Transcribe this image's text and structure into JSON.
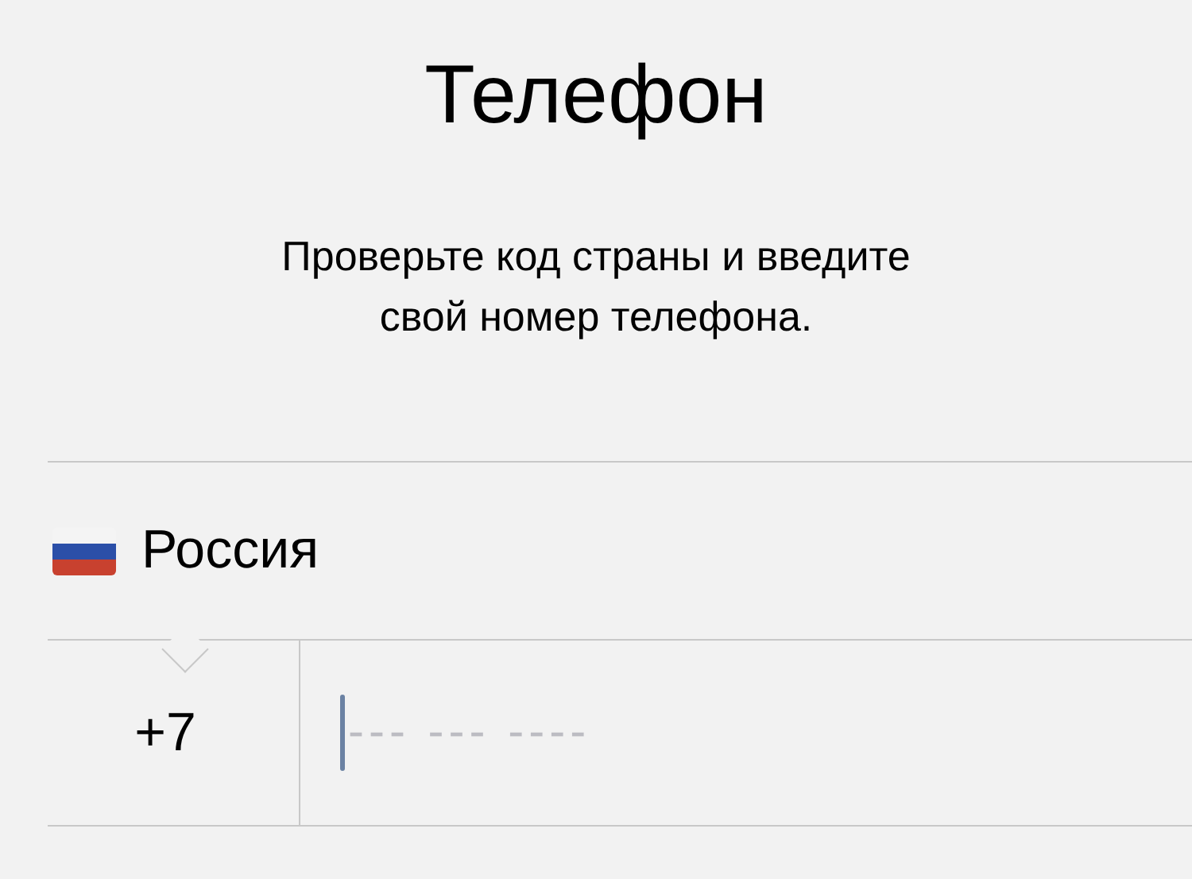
{
  "title": "Телефон",
  "subtitle": "Проверьте код страны и введите свой номер телефона.",
  "country": {
    "name": "Россия"
  },
  "phone": {
    "code": "+7",
    "placeholder": "--- --- ----",
    "focused": true
  }
}
